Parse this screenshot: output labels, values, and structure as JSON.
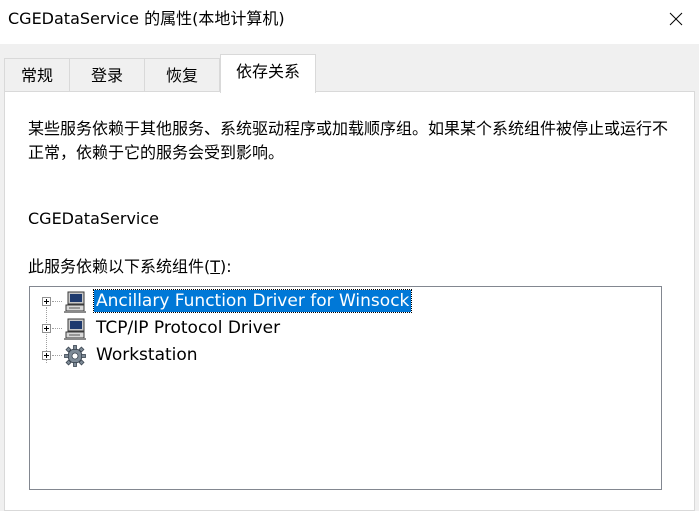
{
  "window": {
    "title": "CGEDataService 的属性(本地计算机)"
  },
  "tabs": [
    {
      "label": "常规",
      "active": false
    },
    {
      "label": "登录",
      "active": false
    },
    {
      "label": "恢复",
      "active": false
    },
    {
      "label": "依存关系",
      "active": true
    }
  ],
  "dependencies": {
    "description": "某些服务依赖于其他服务、系统驱动程序或加载顺序组。如果某个系统组件被停止或运行不正常，依赖于它的服务会受到影响。",
    "service_name": "CGEDataService",
    "depends_on_label_prefix": "此服务依赖以下系统组件(",
    "depends_on_label_accel": "T",
    "depends_on_label_suffix": "):",
    "tree_items": [
      {
        "label": "Ancillary Function Driver for Winsock",
        "icon": "computer-icon",
        "selected": true
      },
      {
        "label": "TCP/IP Protocol Driver",
        "icon": "computer-icon",
        "selected": false
      },
      {
        "label": "Workstation",
        "icon": "gear-icon",
        "selected": false
      }
    ]
  },
  "colors": {
    "selection": "#0078d7",
    "window_bg": "#f0f0f0",
    "panel_bg": "#ffffff"
  }
}
